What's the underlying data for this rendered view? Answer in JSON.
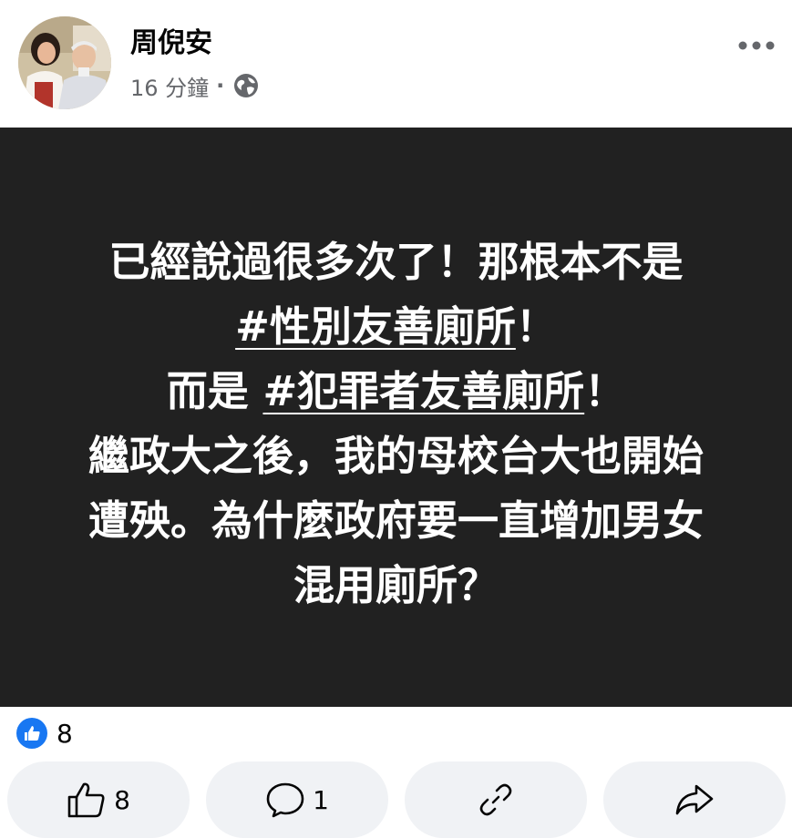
{
  "post": {
    "author": "周倪安",
    "time": "16 分鐘",
    "separator": "·",
    "privacy_icon": "globe-icon",
    "more_icon": "more-dots-icon",
    "text_lines": [
      {
        "before": "已經說過很多次了！那根本不是",
        "tag": "",
        "after": ""
      },
      {
        "before": "",
        "tag": "#性別友善廁所",
        "after": "！"
      },
      {
        "before": "而是 ",
        "tag": "#犯罪者友善廁所",
        "after": "！"
      },
      {
        "before": "繼政大之後，我的母校台大也開始",
        "tag": "",
        "after": ""
      },
      {
        "before": "遭殃。為什麼政府要一直增加男女",
        "tag": "",
        "after": ""
      },
      {
        "before": "混用廁所？",
        "tag": "",
        "after": ""
      }
    ],
    "background_color": "#212121"
  },
  "reactions": {
    "icon": "like-reaction-icon",
    "count": "8",
    "accent": "#1877f2"
  },
  "actions": {
    "like": {
      "icon": "thumbs-up-icon",
      "count": "8"
    },
    "comment": {
      "icon": "comment-icon",
      "count": "1"
    },
    "copy_link": {
      "icon": "link-icon"
    },
    "share": {
      "icon": "share-icon"
    }
  }
}
